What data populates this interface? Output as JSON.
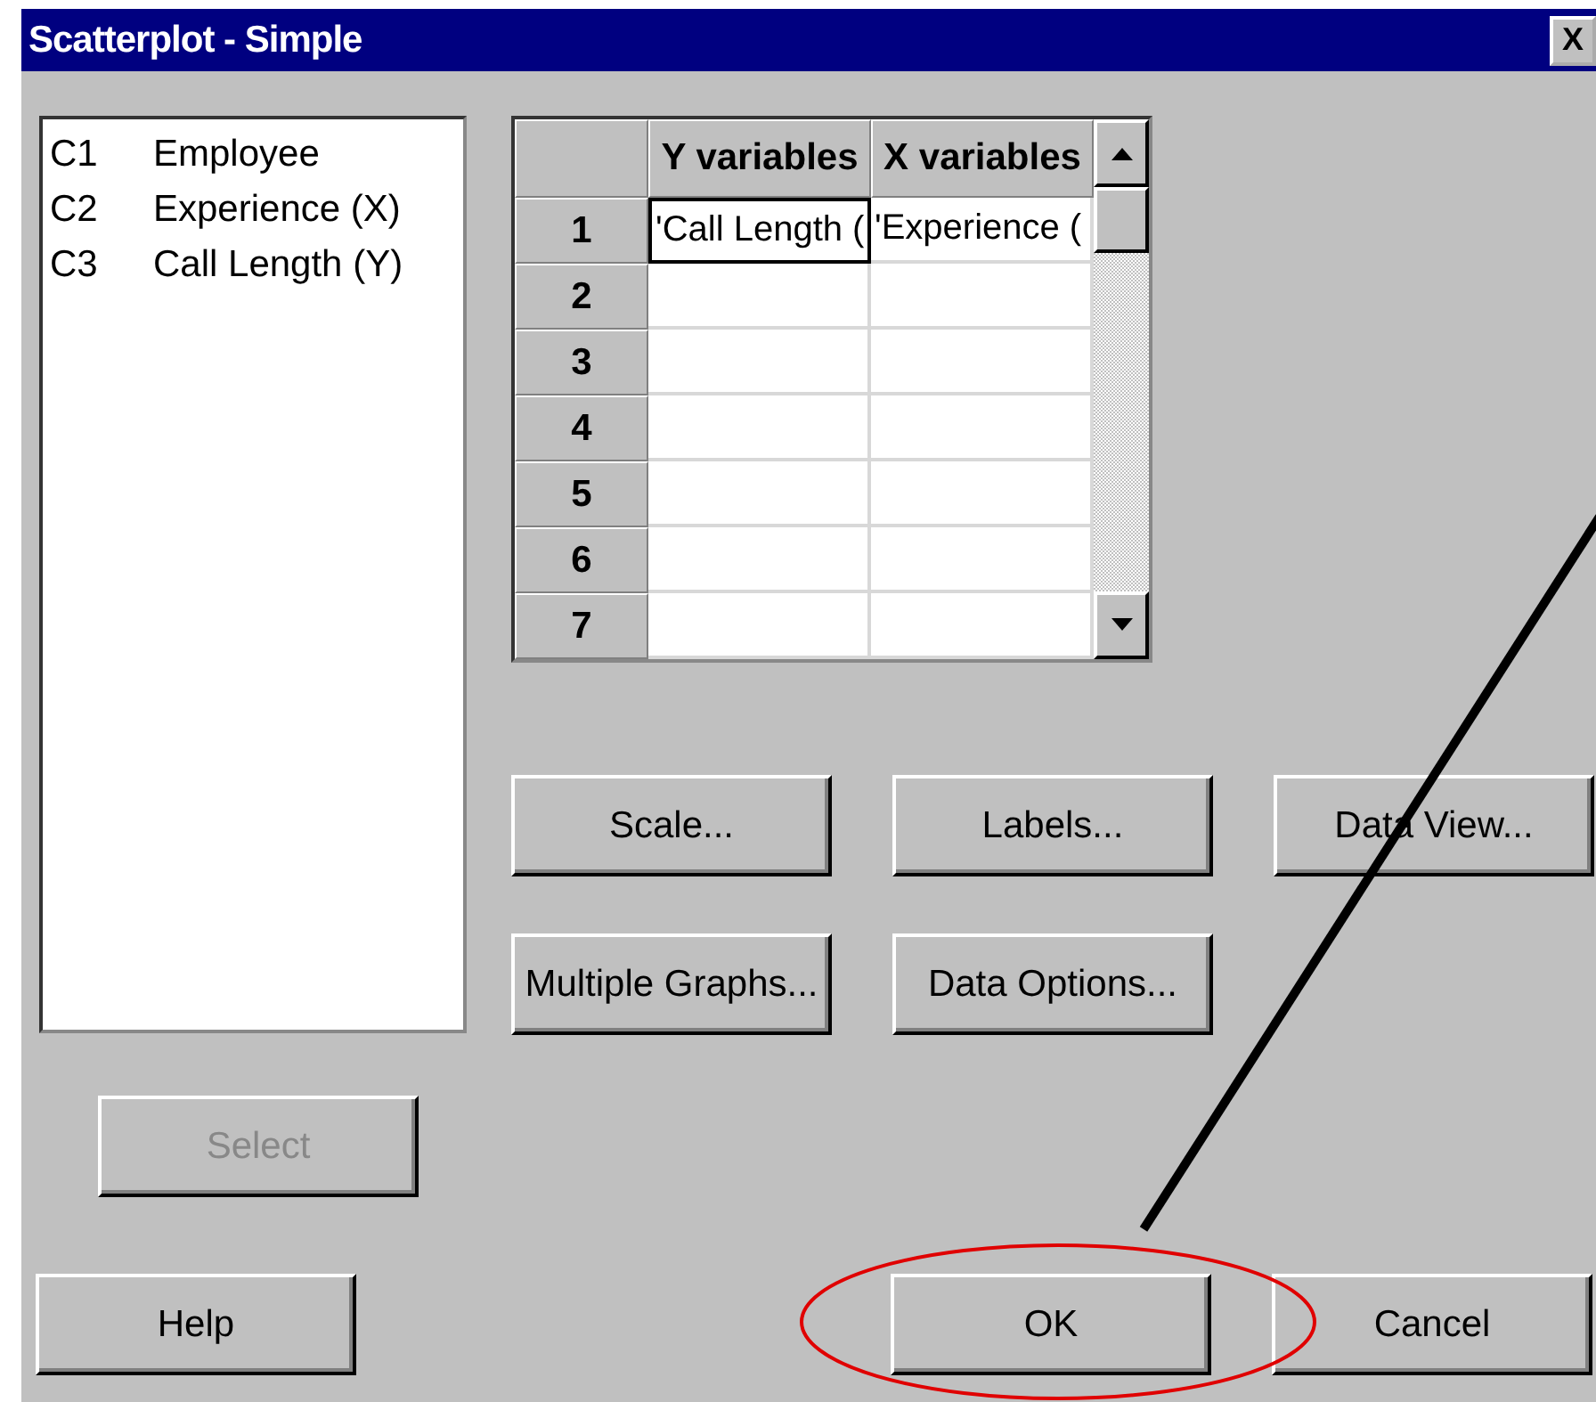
{
  "window": {
    "title": "Scatterplot - Simple",
    "close": "X"
  },
  "variables": [
    {
      "column": "C1",
      "name": "Employee"
    },
    {
      "column": "C2",
      "name": "Experience (X)"
    },
    {
      "column": "C3",
      "name": "Call Length (Y)"
    }
  ],
  "select_button": {
    "label": "Select",
    "disabled": true
  },
  "table": {
    "columns": [
      "Y variables",
      "X variables"
    ],
    "rows": [
      {
        "number": "1",
        "cells": [
          {
            "value": "'Call Length (",
            "selected": true
          },
          {
            "value": "'Experience (",
            "selected": false
          }
        ]
      },
      {
        "number": "2",
        "cells": [
          {
            "selected": false
          },
          {
            "selected": false
          }
        ]
      },
      {
        "number": "3",
        "cells": [
          {
            "selected": false
          },
          {
            "selected": false
          }
        ]
      },
      {
        "number": "4",
        "cells": [
          {
            "selected": false
          },
          {
            "selected": false
          }
        ]
      },
      {
        "number": "5",
        "cells": [
          {
            "selected": false
          },
          {
            "selected": false
          }
        ]
      },
      {
        "number": "6",
        "cells": [
          {
            "selected": false
          },
          {
            "selected": false
          }
        ]
      },
      {
        "number": "7",
        "cells": [
          {
            "selected": false
          },
          {
            "selected": false
          }
        ]
      }
    ]
  },
  "option_buttons": [
    "Scale...",
    "Labels...",
    "Data View...",
    "Multiple Graphs...",
    "Data Options..."
  ],
  "bottom_buttons": {
    "help": "Help",
    "ok": "OK",
    "cancel": "Cancel",
    "ok_highlighted": true
  }
}
